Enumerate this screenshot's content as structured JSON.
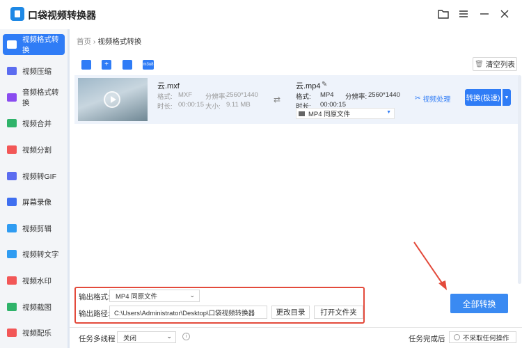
{
  "app": {
    "title": "口袋视频转换器"
  },
  "sidebar": {
    "items": [
      {
        "label": "视频格式转换",
        "color": "#ffffff",
        "active": true
      },
      {
        "label": "视频压缩",
        "color": "#5b6cf0"
      },
      {
        "label": "音频格式转换",
        "color": "#8a4cf0"
      },
      {
        "label": "视频合并",
        "color": "#2fb36a"
      },
      {
        "label": "视频分割",
        "color": "#f25757"
      },
      {
        "label": "视频转GIF",
        "color": "#5b6cf0"
      },
      {
        "label": "屏幕录像",
        "color": "#3f6ff0"
      },
      {
        "label": "视频剪辑",
        "color": "#2f9cf2"
      },
      {
        "label": "视频转文字",
        "color": "#2f9cf2"
      },
      {
        "label": "视频水印",
        "color": "#f25757"
      },
      {
        "label": "视频截图",
        "color": "#2fb36a"
      },
      {
        "label": "视频配乐",
        "color": "#f25757"
      }
    ]
  },
  "breadcrumb": {
    "home": "首页",
    "sep": "›",
    "current": "视频格式转换"
  },
  "toolbar": {
    "clear_label": "清空列表"
  },
  "file": {
    "source_name": "云.mxf",
    "format_label": "格式:",
    "format_value": "MXF",
    "res_label": "分辨率:",
    "res_value": "2560*1440",
    "duration_label": "时长:",
    "duration_value": "00:00:15",
    "size_label": "大小:",
    "size_value": "9.11 MB",
    "target_name": "云.mp4",
    "target_format_value": "MP4",
    "target_res_value": "2560*1440",
    "target_duration_value": "00:00:15",
    "output_select": "MP4  同原文件",
    "process_label": "视频处理",
    "convert_label": "转换(极速)"
  },
  "output": {
    "format_label": "输出格式:",
    "format_value": "MP4  同原文件",
    "path_label": "输出路径:",
    "path_value": "C:\\Users\\Administrator\\Desktop\\口袋视频转换器",
    "change_dir": "更改目录",
    "open_folder": "打开文件夹"
  },
  "all_convert_label": "全部转换",
  "bottom": {
    "multithread_label": "任务多线程",
    "multithread_value": "关闭",
    "after_label": "任务完成后",
    "after_value": "不采取任何操作"
  },
  "colors": {
    "accent": "#2f7cf6",
    "highlight_border": "#e34a3b"
  }
}
